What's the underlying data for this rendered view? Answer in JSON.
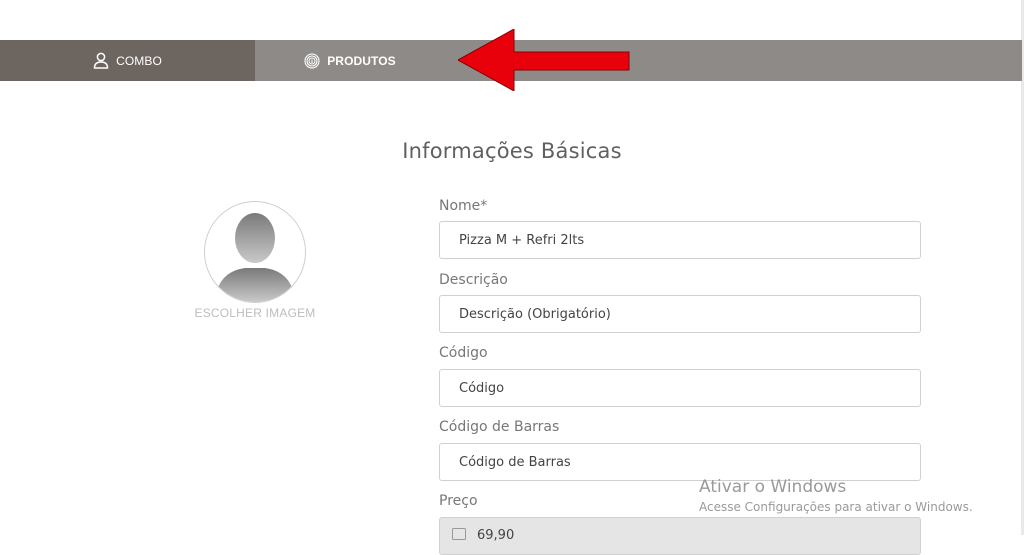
{
  "tabs": {
    "combo": {
      "label": "COMBO",
      "icon": "user-icon"
    },
    "produtos": {
      "label": "PRODUTOS",
      "icon": "fingerprint-icon"
    }
  },
  "section": {
    "title": "Informações Básicas"
  },
  "avatar": {
    "label": "ESCOLHER IMAGEM",
    "icon": "person-silhouette-icon"
  },
  "form": {
    "nome": {
      "label": "Nome*",
      "value": "Pizza M + Refri 2lts"
    },
    "descricao": {
      "label": "Descrição",
      "placeholder": "Descrição (Obrigatório)"
    },
    "codigo": {
      "label": "Código",
      "placeholder": "Código"
    },
    "codigo_barras": {
      "label": "Código de Barras",
      "placeholder": "Código de Barras"
    },
    "preco": {
      "label": "Preço",
      "value": "69,90"
    }
  },
  "watermark": {
    "title": "Ativar o Windows",
    "subtitle": "Acesse Configurações para ativar o Windows."
  },
  "colors": {
    "tab_active": "#6d6560",
    "tab_bar": "#8d8a87",
    "arrow": "#e8000b"
  }
}
